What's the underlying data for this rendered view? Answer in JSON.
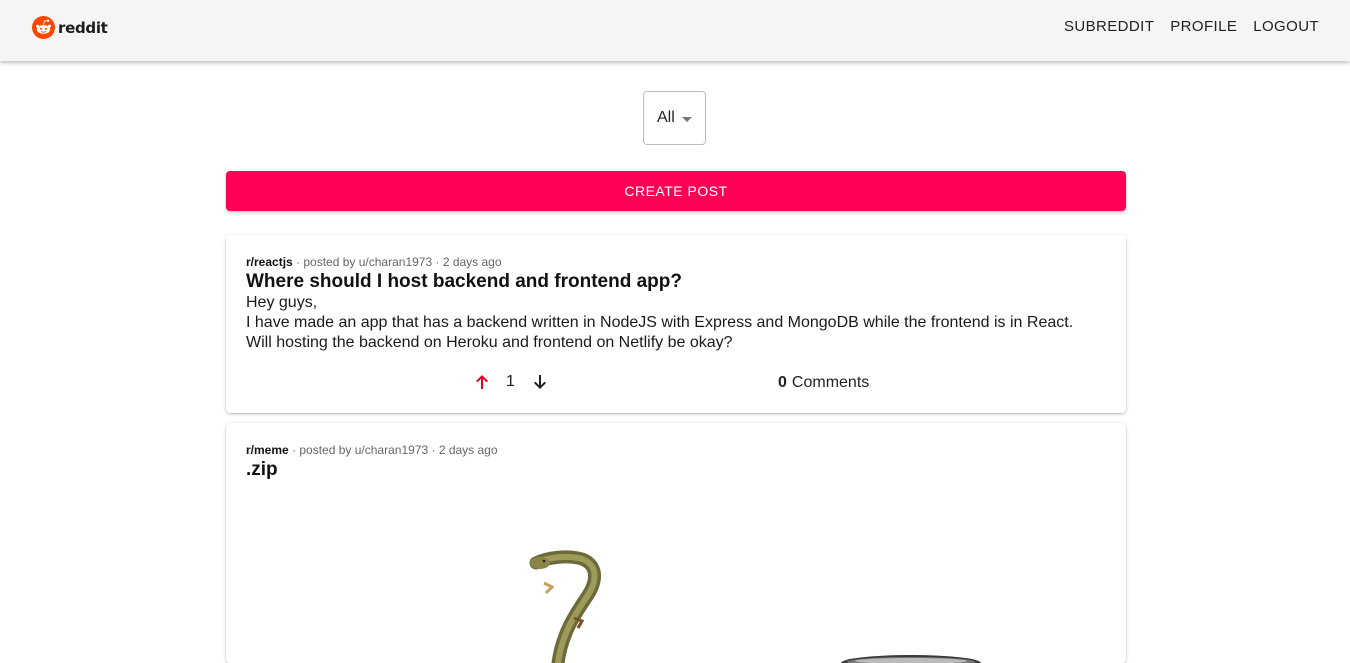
{
  "navbar": {
    "logo_text": "reddit",
    "links": [
      "SUBREDDIT",
      "PROFILE",
      "LOGOUT"
    ]
  },
  "filter": {
    "selected": "All"
  },
  "create_post_label": "CREATE POST",
  "posts": [
    {
      "subreddit": "r/reactjs",
      "posted_by": "posted by u/charan1973",
      "time": "2 days ago",
      "title": "Where should I host backend and frontend app?",
      "body": [
        "Hey guys,",
        "I have made an app that has a backend written in NodeJS with Express and MongoDB while the frontend is in React.",
        "Will hosting the backend on Heroku and frontend on Netlify be okay?"
      ],
      "votes": "1",
      "comment_count": "0",
      "comments_label": "Comments"
    },
    {
      "subreddit": "r/meme",
      "posted_by": "posted by u/charan1973",
      "time": "2 days ago",
      "title": ".zip",
      "image_icon": "snake-and-zip-meme-image"
    }
  ],
  "colors": {
    "accent": "#ff0055",
    "upvote_active": "#e8001c",
    "navbar_bg": "#f5f5f5"
  }
}
